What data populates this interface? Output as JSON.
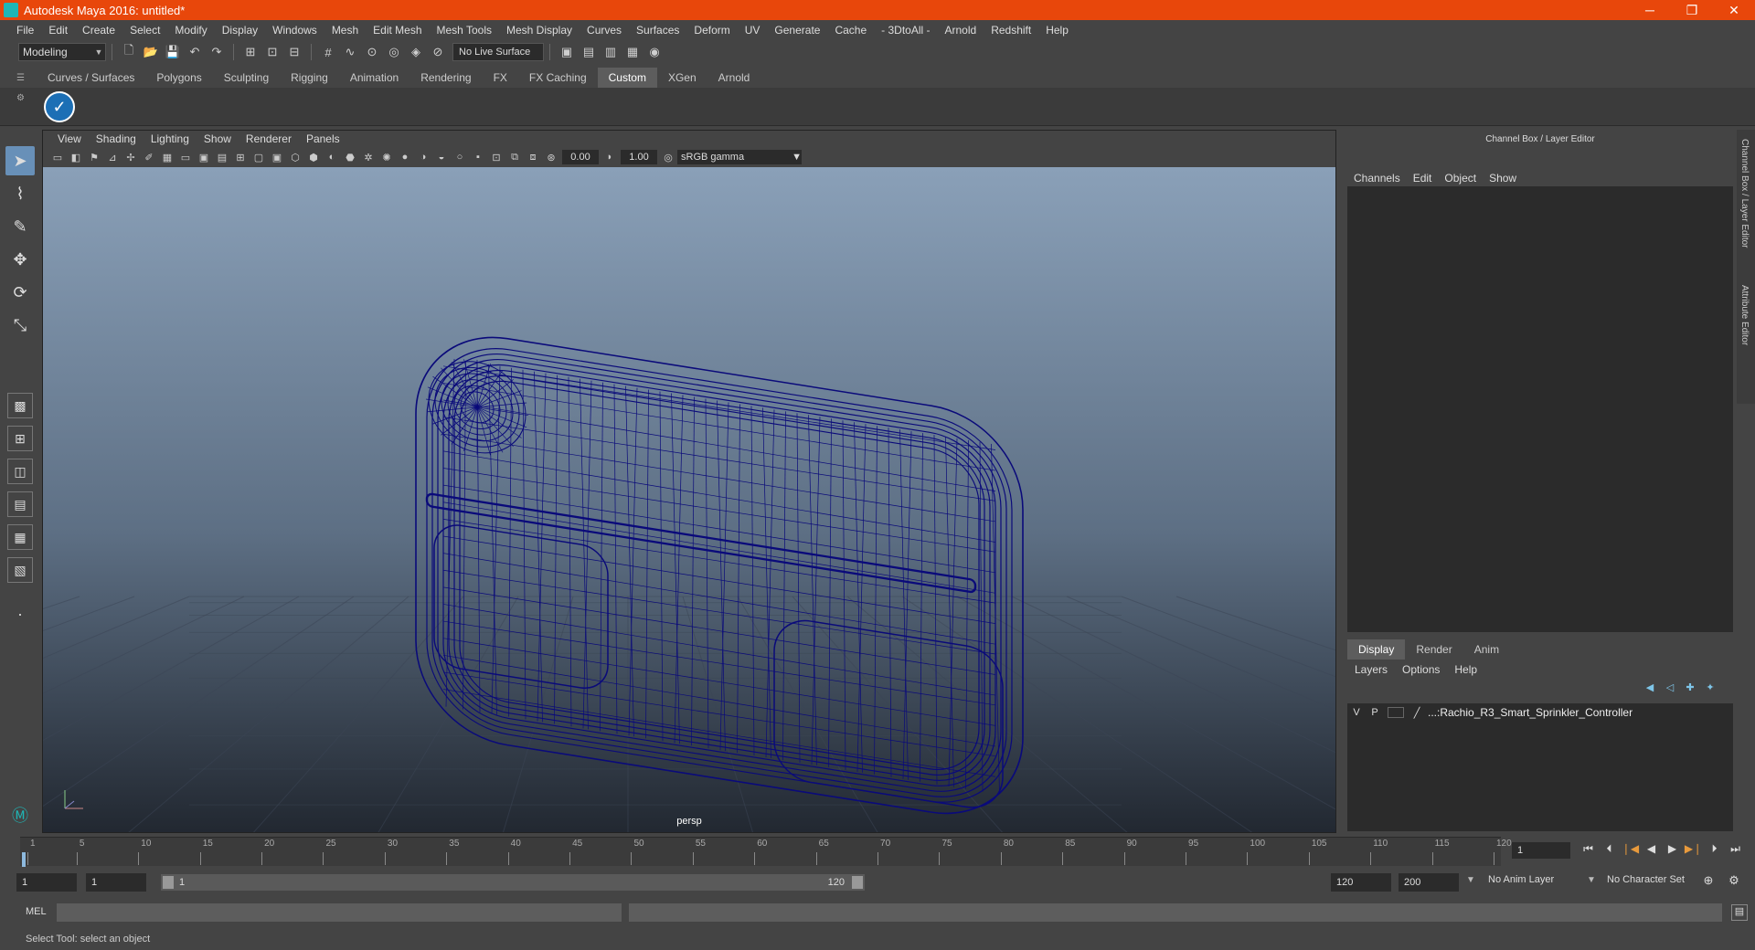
{
  "window": {
    "title": "Autodesk Maya 2016: untitled*",
    "controls": [
      "─",
      "❐",
      "✕"
    ]
  },
  "menubar": [
    "File",
    "Edit",
    "Create",
    "Select",
    "Modify",
    "Display",
    "Windows",
    "Mesh",
    "Edit Mesh",
    "Mesh Tools",
    "Mesh Display",
    "Curves",
    "Surfaces",
    "Deform",
    "UV",
    "Generate",
    "Cache",
    "- 3DtoAll -",
    "Arnold",
    "Redshift",
    "Help"
  ],
  "statusline": {
    "mode": "Modeling",
    "live_surface": "No Live Surface"
  },
  "shelf": {
    "tabs": [
      "Curves / Surfaces",
      "Polygons",
      "Sculpting",
      "Rigging",
      "Animation",
      "Rendering",
      "FX",
      "FX Caching",
      "Custom",
      "XGen",
      "Arnold"
    ],
    "active_tab": "Custom"
  },
  "viewport": {
    "menu": [
      "View",
      "Shading",
      "Lighting",
      "Show",
      "Renderer",
      "Panels"
    ],
    "exposure": "0.00",
    "gamma_value": "1.00",
    "color_space": "sRGB gamma",
    "camera": "persp",
    "wire_color": "#0a0a7a"
  },
  "channel_box": {
    "title": "Channel Box / Layer Editor",
    "menu": [
      "Channels",
      "Edit",
      "Object",
      "Show"
    ],
    "layer_tabs": [
      "Display",
      "Render",
      "Anim"
    ],
    "active_layer_tab": "Display",
    "layer_menu": [
      "Layers",
      "Options",
      "Help"
    ],
    "layers": [
      {
        "v": "V",
        "p": "P",
        "name": "...:Rachio_R3_Smart_Sprinkler_Controller"
      }
    ],
    "side_tabs": [
      "Channel Box / Layer Editor",
      "Attribute Editor"
    ]
  },
  "timeline": {
    "ticks": [
      "1",
      "5",
      "10",
      "15",
      "20",
      "25",
      "30",
      "35",
      "40",
      "45",
      "50",
      "55",
      "60",
      "65",
      "70",
      "75",
      "80",
      "85",
      "90",
      "95",
      "100",
      "105",
      "110",
      "115",
      "120"
    ],
    "current_frame": "1"
  },
  "range": {
    "start_min": "1",
    "start": "1",
    "slider_start": "1",
    "slider_end": "120",
    "end": "120",
    "end_max": "200",
    "anim_layer": "No Anim Layer",
    "character_set": "No Character Set"
  },
  "command_line": {
    "label": "MEL"
  },
  "help_line": {
    "text": "Select Tool: select an object"
  },
  "colors": {
    "title_bar": "#e8470b",
    "active_tab": "#5d5d5d",
    "tool_active": "#6890b8"
  }
}
